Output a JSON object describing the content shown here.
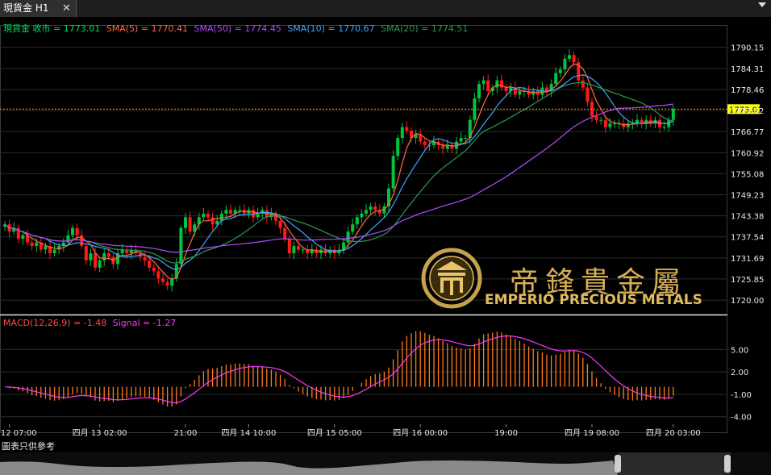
{
  "tab": {
    "title": "現貨金 H1",
    "close_symbol": "✕"
  },
  "chart_data": [
    {
      "type": "candlestick",
      "symbol": "現貨金 收市",
      "last": 1773.01,
      "last_label": "1773.01",
      "ylim": [
        1718,
        1793
      ],
      "y_ticks": [
        "1790.15",
        "1784.31",
        "1778.46",
        "1772.62",
        "1766.77",
        "1760.92",
        "1755.08",
        "1749.23",
        "1743.38",
        "1737.54",
        "1731.69",
        "1725.85",
        "1720.00"
      ],
      "x_ticks": [
        "四月 12 07:00",
        "四月 13 02:00",
        "21:00",
        "四月 14 10:00",
        "四月 15 05:00",
        "四月 16 00:00",
        "19:00",
        "四月 19 08:00",
        "四月 20 03:00"
      ],
      "x_tick_index": [
        1,
        21,
        40,
        54,
        73,
        92,
        111,
        130,
        148
      ],
      "closes": [
        1741,
        1739,
        1740,
        1737,
        1738,
        1736,
        1735,
        1736,
        1734,
        1735,
        1733,
        1734,
        1735,
        1736,
        1738,
        1740,
        1738,
        1735,
        1731,
        1733,
        1729,
        1731,
        1733,
        1732,
        1730,
        1733,
        1734,
        1733,
        1734,
        1733,
        1732,
        1731,
        1729,
        1728,
        1726,
        1725,
        1724,
        1726,
        1730,
        1740,
        1743,
        1739,
        1741,
        1743,
        1744,
        1743,
        1741,
        1742,
        1744,
        1745,
        1744,
        1745,
        1745,
        1744,
        1745,
        1743,
        1744,
        1745,
        1743,
        1744,
        1742,
        1740,
        1737,
        1733,
        1735,
        1734,
        1734,
        1733,
        1734,
        1733,
        1734,
        1733,
        1734,
        1733,
        1734,
        1736,
        1739,
        1741,
        1743,
        1744,
        1745,
        1746,
        1745,
        1744,
        1746,
        1751,
        1760,
        1765,
        1768,
        1767,
        1765,
        1766,
        1764,
        1763,
        1763,
        1764,
        1763,
        1762,
        1763,
        1762,
        1764,
        1765,
        1765,
        1770,
        1776,
        1780,
        1781,
        1778,
        1779,
        1781,
        1779,
        1778,
        1779,
        1777,
        1778,
        1778,
        1777,
        1778,
        1777,
        1779,
        1778,
        1780,
        1783,
        1784,
        1787,
        1788,
        1786,
        1781,
        1779,
        1775,
        1771,
        1770,
        1770,
        1768,
        1769,
        1769,
        1769,
        1768,
        1769,
        1769,
        1770,
        1769,
        1770,
        1769,
        1770,
        1768,
        1768,
        1770,
        1773.01
      ],
      "series": [
        {
          "name": "收市",
          "value": "1773.01",
          "color": "#00e060"
        },
        {
          "name": "SMA(5)",
          "value": "1770.41",
          "color": "#ff6a4a"
        },
        {
          "name": "SMA(50)",
          "value": "1774.45",
          "color": "#b44cff"
        },
        {
          "name": "SMA(10)",
          "value": "1770.67",
          "color": "#3fa6ff"
        },
        {
          "name": "SMA(20)",
          "value": "1774.51",
          "color": "#2e9a50"
        }
      ],
      "up_color": "#00c43c",
      "down_color": "#ff1a1a"
    },
    {
      "type": "bar",
      "name": "MACD(12,26,9)",
      "macd_value": "-1.48",
      "signal_name": "Signal",
      "signal_value": "-1.27",
      "ylim": [
        -5,
        8.5
      ],
      "y_ticks": [
        "5.00",
        "2.00",
        "-1.00",
        "-4.00"
      ],
      "bar_color": "#ff7a1a",
      "signal_color": "#ff33ff"
    }
  ],
  "footer": {
    "note": "圖表只供參考"
  },
  "logo": {
    "cn": "帝鋒貴金屬",
    "en": "EMPERIO PRECIOUS METALS"
  }
}
